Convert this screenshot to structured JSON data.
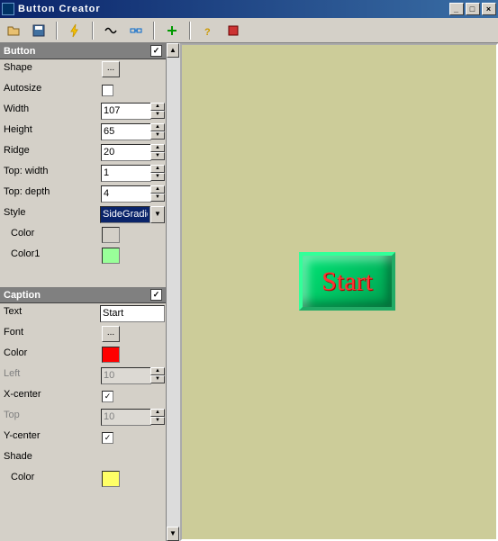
{
  "window": {
    "title": "Button Creator"
  },
  "toolbar": {
    "icons": [
      "open",
      "save",
      "bolt",
      "wave",
      "link",
      "plus",
      "help",
      "stop"
    ]
  },
  "sections": {
    "button": {
      "header": "Button",
      "checked": true,
      "rows": {
        "shape_label": "Shape",
        "autosize_label": "Autosize",
        "width_label": "Width",
        "width_value": "107",
        "height_label": "Height",
        "height_value": "65",
        "ridge_label": "Ridge",
        "ridge_value": "20",
        "topwidth_label": "Top: width",
        "topwidth_value": "1",
        "topdepth_label": "Top: depth",
        "topdepth_value": "4",
        "style_label": "Style",
        "style_value": "SideGradient",
        "color_label": "Color",
        "color_value": "#006633",
        "color1_label": "Color1",
        "color1_value": "#99ff99"
      }
    },
    "caption": {
      "header": "Caption",
      "checked": true,
      "rows": {
        "text_label": "Text",
        "text_value": "Start",
        "font_label": "Font",
        "color_label": "Color",
        "color_value": "#ff0000",
        "left_label": "Left",
        "left_value": "10",
        "xcenter_label": "X-center",
        "xcenter_checked": true,
        "top_label": "Top",
        "top_value": "10",
        "ycenter_label": "Y-center",
        "ycenter_checked": true,
        "shade_label": "Shade",
        "shadecolor_label": "Color",
        "shadecolor_value": "#ffff66"
      }
    }
  },
  "preview": {
    "caption": "Start"
  }
}
